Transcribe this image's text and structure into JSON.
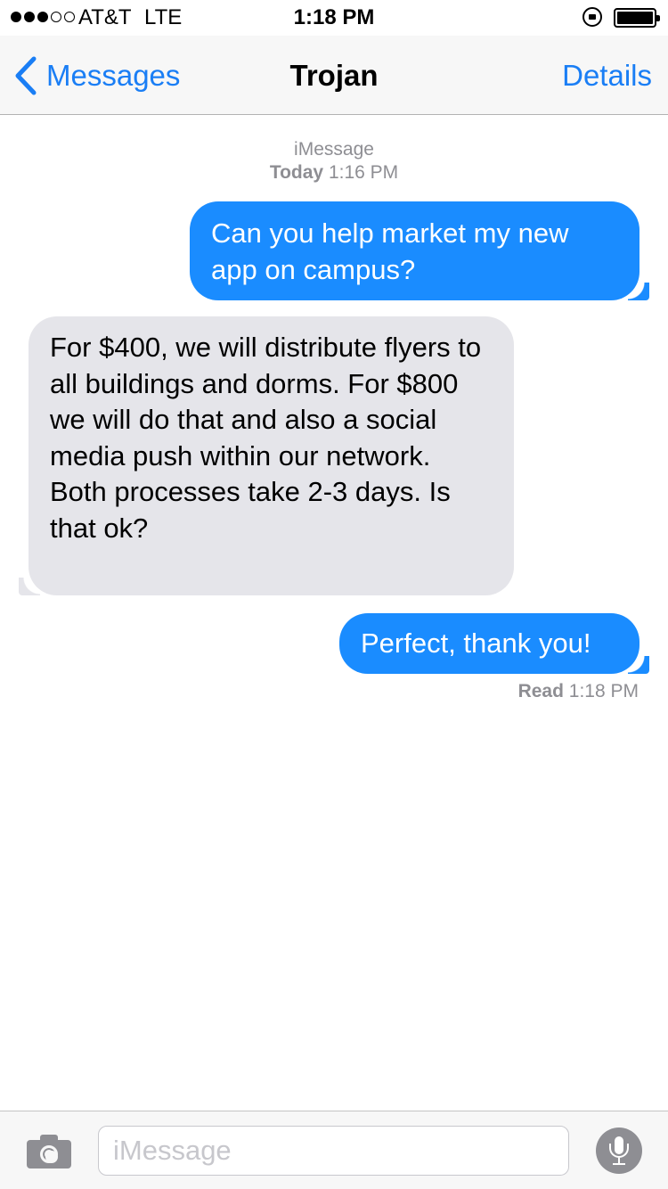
{
  "status_bar": {
    "carrier": "AT&T",
    "network": "LTE",
    "time": "1:18 PM",
    "signal_bars_filled": 3,
    "signal_bars_total": 5,
    "battery_level": 1.0,
    "icons": [
      "signal-dots-icon",
      "rotation-lock-icon",
      "battery-icon"
    ]
  },
  "nav": {
    "back_label": "Messages",
    "title": "Trojan",
    "details_label": "Details",
    "accent_color": "#1a7ef5"
  },
  "thread": {
    "service": "iMessage",
    "timestamp_day": "Today",
    "timestamp_time": "1:16 PM",
    "messages": [
      {
        "direction": "outgoing",
        "text": "Can you help market my new app on campus?"
      },
      {
        "direction": "incoming",
        "text": "For $400, we will distribute flyers to all buildings and dorms. For $800 we will do that and also a social media push within our network. Both processes take 2-3 days. Is that ok?"
      },
      {
        "direction": "outgoing",
        "text": "Perfect, thank you!"
      }
    ],
    "read_label": "Read",
    "read_time": "1:18 PM",
    "colors": {
      "outgoing": "#1a8cff",
      "incoming": "#e5e5ea"
    }
  },
  "input_bar": {
    "placeholder": "iMessage",
    "value": "",
    "icons": [
      "camera-icon",
      "microphone-icon"
    ]
  }
}
